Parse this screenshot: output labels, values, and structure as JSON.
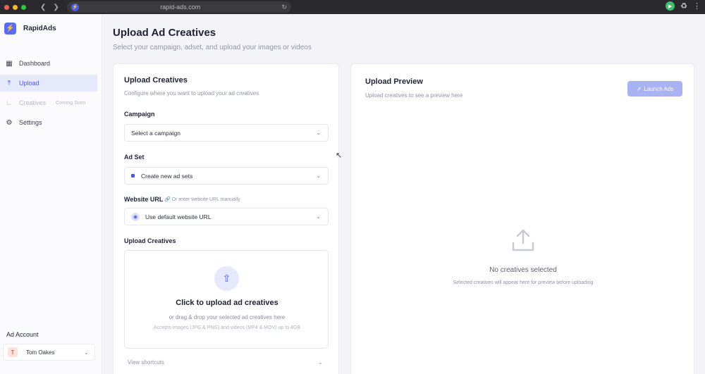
{
  "browser": {
    "url": "rapid-ads.com",
    "traffic_colors": [
      "#ff5f57",
      "#febc2e",
      "#28c840"
    ]
  },
  "sidebar": {
    "brand": "RapidAds",
    "items": [
      {
        "label": "Dashboard",
        "icon": "grid-icon"
      },
      {
        "label": "Upload",
        "icon": "upload-icon"
      },
      {
        "label": "Creatives",
        "icon": "chart-icon",
        "badge": "Coming Soon"
      },
      {
        "label": "Settings",
        "icon": "gear-icon"
      }
    ],
    "account_label": "Ad Account",
    "account_initial": "T",
    "account_name": "Tom Oakes"
  },
  "page": {
    "title": "Upload Ad Creatives",
    "subtitle": "Select your campaign, adset, and upload your images or videos"
  },
  "upload_card": {
    "title": "Upload Creatives",
    "subtitle": "Configure where you want to upload your ad creatives",
    "campaign_label": "Campaign",
    "campaign_value": "Select a campaign",
    "adset_label": "Ad Set",
    "adset_value": "Create new ad sets",
    "url_label": "Website URL",
    "url_note": "Or enter website URL manually",
    "url_value": "Use default website URL",
    "creatives_label": "Upload Creatives",
    "dropzone_title": "Click to upload ad creatives",
    "dropzone_sub": "or drag & drop your selected ad creatives here",
    "dropzone_note": "Accepts images (JPG & PNG) and videos (MP4 & MOV) up to 4GB",
    "shortcuts": "View shortcuts"
  },
  "preview_card": {
    "title": "Upload Preview",
    "subtitle": "Upload creatives to see a preview here",
    "launch_label": "Launch Ads",
    "empty_title": "No creatives selected",
    "empty_sub": "Selected creatives will appear here for preview before uploading"
  },
  "colors": {
    "accent": "#4a5bd8",
    "accent_light": "#a9b3f3",
    "active_bg": "#e6e9fb"
  }
}
